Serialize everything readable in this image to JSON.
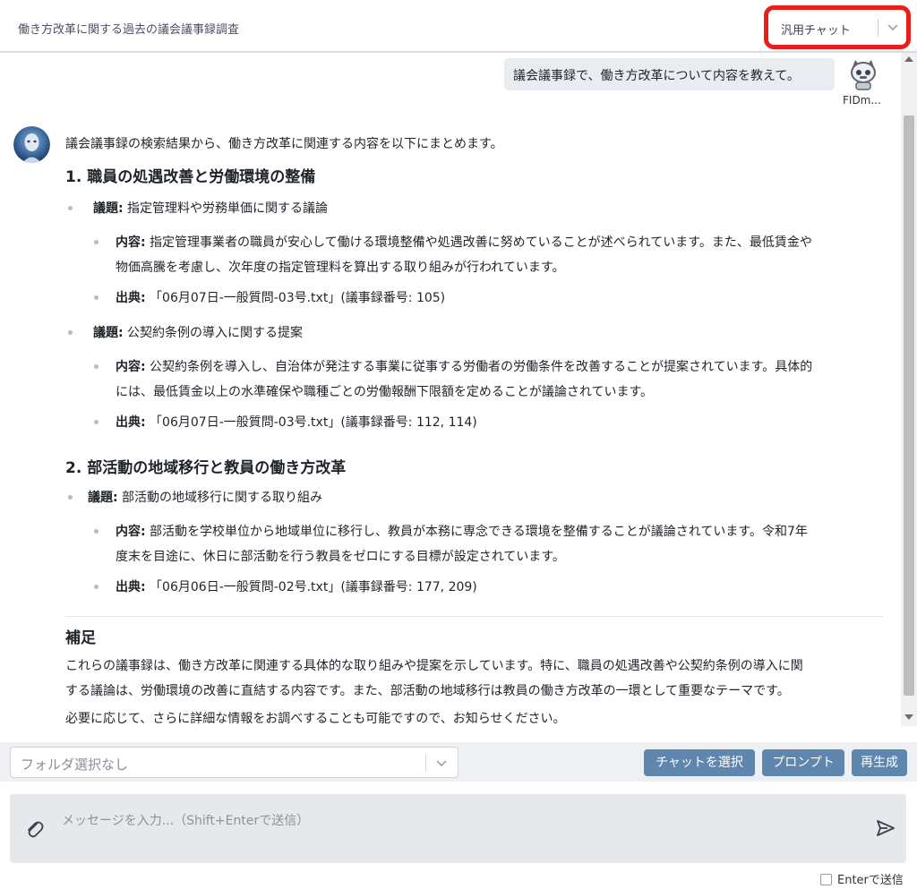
{
  "header": {
    "title": "働き方改革に関する過去の議会議事録調査",
    "chat_mode": "汎用チャット",
    "highlight_color": "#ea1c1c"
  },
  "user_message": {
    "text": "議会議事録で、働き方改革について内容を教えて。",
    "user_name": "FIDm...",
    "avatar_icon": "robot-mascot-icon"
  },
  "assistant": {
    "avatar_icon": "ai-robot-avatar-icon",
    "intro": "議会議事録の検索結果から、働き方改革に関連する内容を以下にまとめます。",
    "section1": {
      "heading": "1. 職員の処遇改善と労働環境の整備",
      "topic1_label": "議題:",
      "topic1_text": " 指定管理料や労務単価に関する議論",
      "t1_content_label": "内容:",
      "t1_content_line1": " 指定管理事業者の職員が安心して働ける環境整備や処遇改善に努めていることが述べられています。また、最低賃金や",
      "t1_content_line2": "物価高騰を考慮し、次年度の指定管理料を算出する取り組みが行われています。",
      "t1_source_label": "出典:",
      "t1_source_text": " 「06月07日-一般質問-03号.txt」(議事録番号: 105)",
      "topic2_label": "議題:",
      "topic2_text": " 公契約条例の導入に関する提案",
      "t2_content_label": "内容:",
      "t2_content_line1": " 公契約条例を導入し、自治体が発注する事業に従事する労働者の労働条件を改善することが提案されています。具体的",
      "t2_content_line2": "には、最低賃金以上の水準確保や職種ごとの労働報酬下限額を定めることが議論されています。",
      "t2_source_label": "出典:",
      "t2_source_text": " 「06月07日-一般質問-03号.txt」(議事録番号: 112, 114)"
    },
    "section2": {
      "heading": "2. 部活動の地域移行と教員の働き方改革",
      "topic1_label": "議題:",
      "topic1_text": " 部活動の地域移行に関する取り組み",
      "t1_content_label": "内容:",
      "t1_content_line1": " 部活動を学校単位から地域単位に移行し、教員が本務に専念できる環境を整備することが議論されています。令和7年",
      "t1_content_line2": "度末を目途に、休日に部活動を行う教員をゼロにする目標が設定されています。",
      "t1_source_label": "出典:",
      "t1_source_text": " 「06月06日-一般質問-02号.txt」(議事録番号: 177, 209)"
    },
    "supplement": {
      "heading": "補足",
      "line1": "これらの議事録は、働き方改革に関連する具体的な取り組みや提案を示しています。特に、職員の処遇改善や公契約条例の導入に関",
      "line2": "する議論は、労働環境の改善に直結する内容です。また、部活動の地域移行は教員の働き方改革の一環として重要なテーマです。",
      "line3": "必要に応じて、さらに詳細な情報をお調べすることも可能ですので、お知らせください。"
    }
  },
  "toolbar": {
    "folder_placeholder": "フォルダ選択なし",
    "select_chat_label": "チャットを選択",
    "prompt_label": "プロンプト",
    "regenerate_label": "再生成",
    "button_color": "#5f87ad"
  },
  "composer": {
    "placeholder": "メッセージを入力...（Shift+Enterで送信）",
    "enter_send_label": "Enterで送信",
    "attach_icon": "paperclip-icon",
    "send_icon": "send-icon"
  }
}
